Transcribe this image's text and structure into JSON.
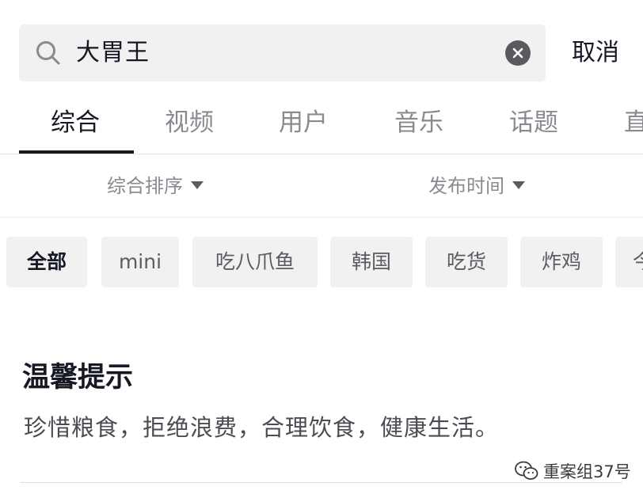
{
  "search": {
    "query": "大胃王",
    "cancel_label": "取消"
  },
  "tabs": [
    {
      "label": "综合",
      "active": true
    },
    {
      "label": "视频"
    },
    {
      "label": "用户"
    },
    {
      "label": "音乐"
    },
    {
      "label": "话题"
    },
    {
      "label": "直"
    }
  ],
  "sort": {
    "left_label": "综合排序",
    "right_label": "发布时间"
  },
  "chips": [
    {
      "label": "全部",
      "active": true
    },
    {
      "label": "mini"
    },
    {
      "label": "吃八爪鱼"
    },
    {
      "label": "韩国"
    },
    {
      "label": "吃货"
    },
    {
      "label": "炸鸡"
    },
    {
      "label": "今"
    }
  ],
  "tip": {
    "title": "温馨提示",
    "text": "珍惜粮食，拒绝浪费，合理饮食，健康生活。"
  },
  "watermark": {
    "text": "重案组37号"
  },
  "colors": {
    "search_bg": "#f1f1f2",
    "active_text": "#161823",
    "inactive_text": "#8a8b91"
  }
}
